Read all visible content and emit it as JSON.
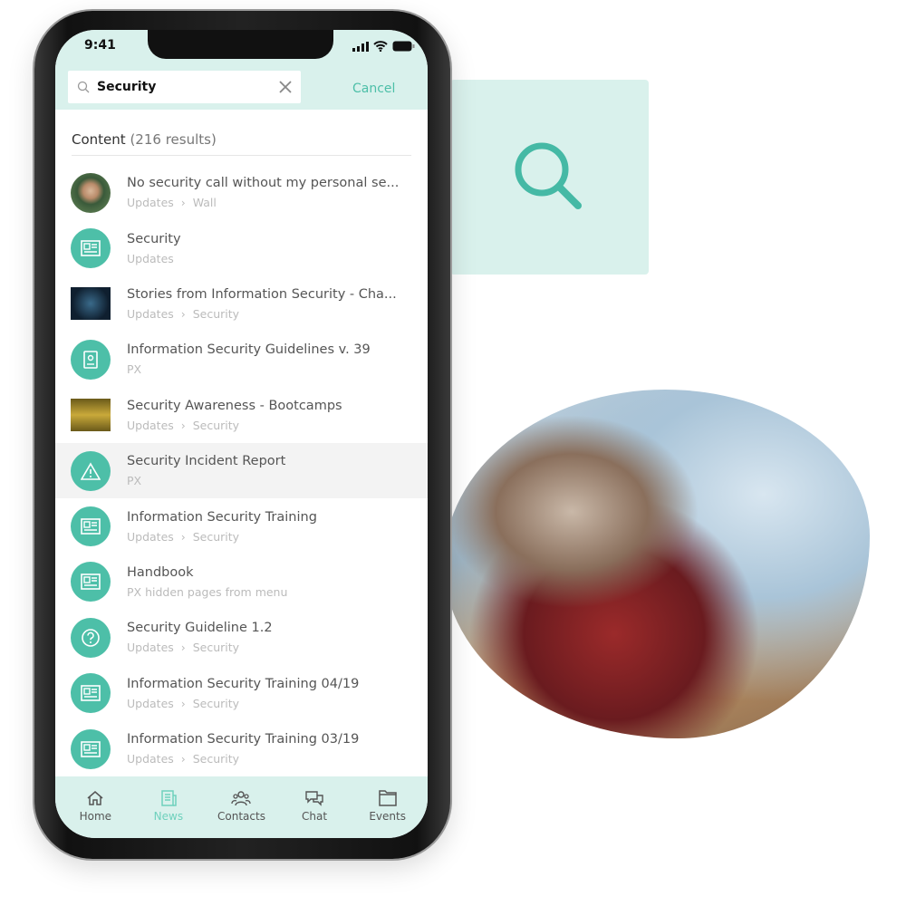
{
  "status": {
    "time": "9:41"
  },
  "search": {
    "query": "Security",
    "cancel": "Cancel"
  },
  "section": {
    "title": "Content",
    "count": "(216 results)"
  },
  "results": [
    {
      "title": "No security call without my personal se...",
      "path": [
        "Updates",
        "Wall"
      ],
      "icon": "avatar-photo"
    },
    {
      "title": "Security",
      "path": [
        "Updates"
      ],
      "icon": "newspaper"
    },
    {
      "title": "Stories from Information Security - Cha...",
      "path": [
        "Updates",
        "Security"
      ],
      "icon": "thumbnail"
    },
    {
      "title": "Information Security Guidelines v. 39",
      "path": [
        "PX"
      ],
      "icon": "contact-card"
    },
    {
      "title": "Security Awareness - Bootcamps",
      "path": [
        "Updates",
        "Security"
      ],
      "icon": "thumbnail"
    },
    {
      "title": "Security Incident Report",
      "path": [
        "PX"
      ],
      "icon": "warning",
      "highlighted": true
    },
    {
      "title": "Information Security Training",
      "path": [
        "Updates",
        "Security"
      ],
      "icon": "newspaper"
    },
    {
      "title": "Handbook",
      "path": [
        "PX hidden pages from menu"
      ],
      "icon": "newspaper"
    },
    {
      "title": "Security Guideline 1.2",
      "path": [
        "Updates",
        "Security"
      ],
      "icon": "question"
    },
    {
      "title": "Information Security Training 04/19",
      "path": [
        "Updates",
        "Security"
      ],
      "icon": "newspaper"
    },
    {
      "title": "Information Security Training 03/19",
      "path": [
        "Updates",
        "Security"
      ],
      "icon": "newspaper"
    }
  ],
  "tabs": [
    {
      "label": "Home",
      "icon": "home"
    },
    {
      "label": "News",
      "icon": "news",
      "active": true
    },
    {
      "label": "Contacts",
      "icon": "contacts"
    },
    {
      "label": "Chat",
      "icon": "chat"
    },
    {
      "label": "Events",
      "icon": "folder"
    }
  ],
  "colors": {
    "accent": "#4dbfa8",
    "header_bg": "#d9f1ec"
  }
}
